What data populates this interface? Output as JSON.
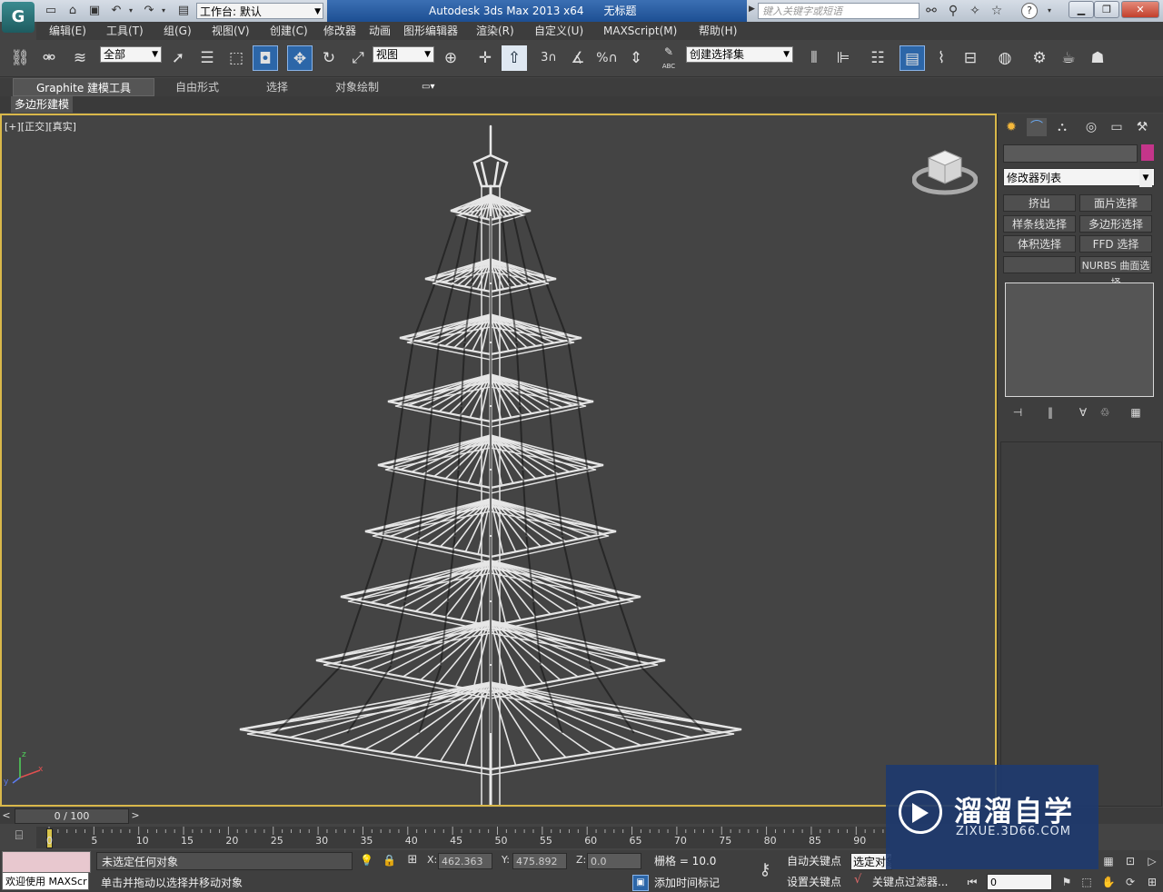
{
  "titlebar": {
    "workspace": "工作台: 默认",
    "app_title": "Autodesk 3ds Max  2013 x64",
    "document": "无标题",
    "search_placeholder": "键入关键字或短语",
    "help_symbol": "?"
  },
  "menu": [
    "编辑(E)",
    "工具(T)",
    "组(G)",
    "视图(V)",
    "创建(C)",
    "修改器",
    "动画",
    "图形编辑器",
    "渲染(R)",
    "自定义(U)",
    "MAXScript(M)",
    "帮助(H)"
  ],
  "toolbar": {
    "selection_filter": "全部",
    "ref_coord": "视图",
    "named_selection": "创建选择集",
    "snap_3": "3",
    "percent_snap": "%",
    "abc_label": "ABC"
  },
  "ribbon": {
    "tabs": [
      "Graphite 建模工具",
      "自由形式",
      "选择",
      "对象绘制"
    ],
    "subtab": "多边形建模"
  },
  "viewport": {
    "label": "[+][正交][真实]",
    "axis_x": "x",
    "axis_y": "y",
    "axis_z": "z"
  },
  "command_panel": {
    "modifier_list": "修改器列表",
    "buttons": [
      "挤出",
      "面片选择",
      "样条线选择",
      "多边形选择",
      "体积选择",
      "FFD 选择",
      "",
      "NURBS 曲面选择"
    ]
  },
  "timeline": {
    "frame_display": "0 / 100",
    "ticks": [
      "0",
      "5",
      "10",
      "15",
      "20",
      "25",
      "30",
      "35",
      "40",
      "45",
      "50",
      "55",
      "60",
      "65",
      "70",
      "75",
      "80",
      "85",
      "90"
    ]
  },
  "status": {
    "maxscript_text": "欢迎使用 MAXScr",
    "selection_status": "未选定任何对象",
    "prompt": "单击并拖动以选择并移动对象",
    "x_label": "X:",
    "x_value": "462.363",
    "y_label": "Y:",
    "y_value": "475.892",
    "z_label": "Z:",
    "z_value": "0.0",
    "grid": "栅格 = 10.0",
    "add_time_tag": "添加时间标记",
    "auto_key": "自动关键点",
    "set_key": "设置关键点",
    "selected_dropdown": "选定对象",
    "key_filters": "关键点过滤器...",
    "frame": "0"
  },
  "watermark": {
    "title": "溜溜自学",
    "url": "ZIXUE.3D66.COM"
  },
  "colors": {
    "viewport_border": "#d9b84a",
    "title_blue": "#1d4f93",
    "swatch": "#c4358a",
    "watermark_bg": "#1e3a6e"
  }
}
